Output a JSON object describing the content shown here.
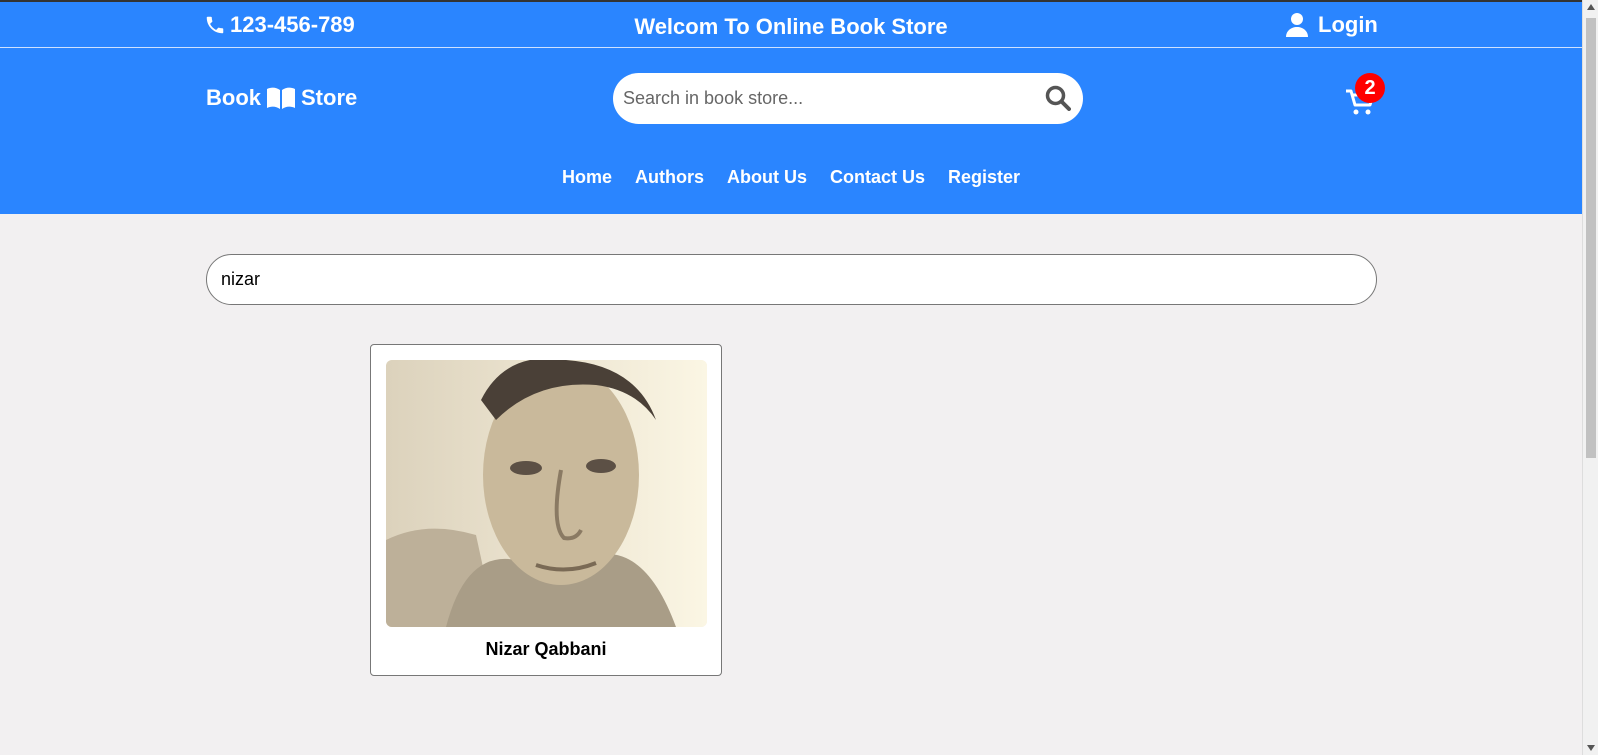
{
  "topbar": {
    "phone": "123-456-789",
    "welcome": "Welcom To Online Book Store",
    "login": "Login",
    "phone_icon": "phone-icon",
    "user_icon": "user-icon"
  },
  "header": {
    "logo_left": "Book",
    "logo_right": "Store",
    "logo_icon": "open-book-icon",
    "search_placeholder": "Search in book store...",
    "search_icon": "search-icon",
    "cart_icon": "cart-icon",
    "cart_count": "2"
  },
  "nav": {
    "items": [
      "Home",
      "Authors",
      "About Us",
      "Contact Us",
      "Register"
    ]
  },
  "filter": {
    "value": "nizar"
  },
  "results": [
    {
      "name": "Nizar Qabbani"
    }
  ],
  "colors": {
    "primary": "#2a85ff",
    "background": "#f2f0f1",
    "badge": "#ff0000"
  }
}
